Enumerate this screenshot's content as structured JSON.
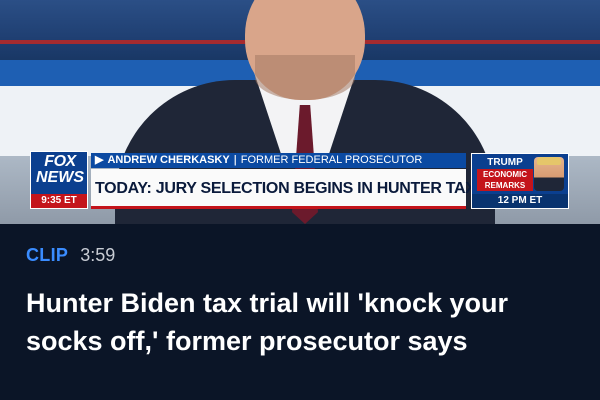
{
  "video": {
    "channel_logo_top": "FOX",
    "channel_logo_bottom": "NEWS",
    "timestamp": "9:35 ET",
    "name_arrow": "▶",
    "guest_name": "ANDREW CHERKASKY",
    "guest_title": "FORMER FEDERAL PROSECUTOR",
    "headline": "TODAY: JURY SELECTION BEGINS IN HUNTER TAX TRIAL",
    "promo": {
      "name": "TRUMP",
      "subtitle": "ECONOMIC REMARKS",
      "time": "12 PM ET"
    }
  },
  "meta": {
    "label": "CLIP",
    "duration": "3:59"
  },
  "article": {
    "title": "Hunter Biden tax trial will 'knock your socks off,' former prosecutor says"
  },
  "colors": {
    "background": "#0b1527",
    "clip_label": "#3a8cff",
    "fox_blue": "#0b3f8f",
    "fox_red": "#c4141b"
  }
}
